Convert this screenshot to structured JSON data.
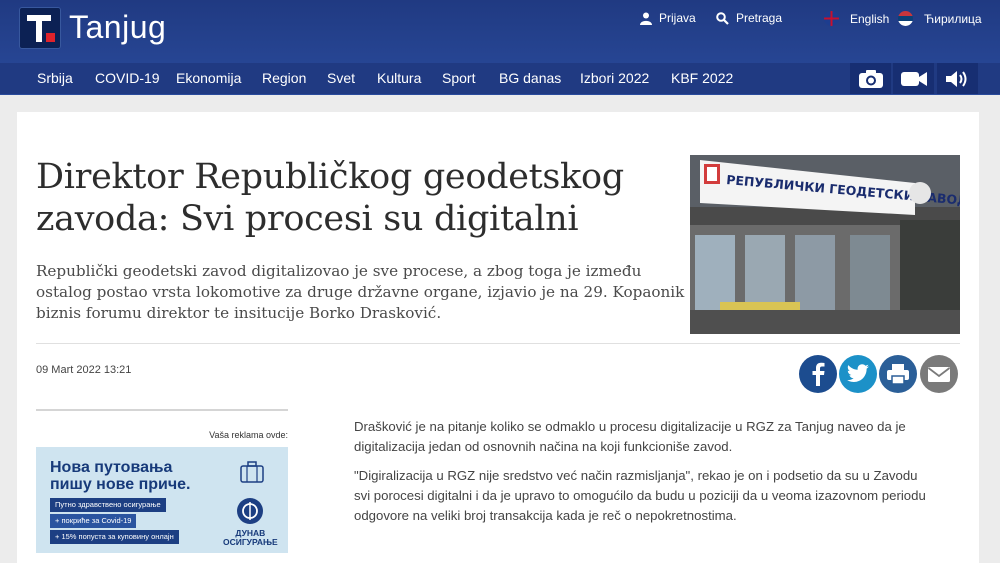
{
  "site": {
    "name": "Tanjug"
  },
  "util": {
    "login": "Prijava",
    "search": "Pretraga",
    "english": "English",
    "cyrillic": "Ћирилица"
  },
  "nav": {
    "items": [
      "Srbija",
      "COVID-19",
      "Ekonomija",
      "Region",
      "Svet",
      "Kultura",
      "Sport",
      "BG danas",
      "Izbori 2022",
      "KBF 2022"
    ]
  },
  "media": {
    "icons": [
      "camera-icon",
      "video-icon",
      "audio-icon"
    ]
  },
  "article": {
    "title": "Direktor Republičkog geodetskog zavoda: Svi procesi su digitalni",
    "lead": "Republički geodetski zavod digitalizovao je sve procese, a zbog toga je između ostalog postao vrsta lokomotive za druge državne organe, izjavio je na 29. Kopaonik biznis forumu direktor te insitucije Borko Drasković.",
    "date": "09 Mart 2022 13:21",
    "paragraphs": [
      "Drašković je na pitanje koliko se odmaklo u procesu digitalizacije u RGZ za Tanjug naveo da je digitalizacija jedan od osnovnih načina na koji funkcioniše zavod.",
      "\"Digiralizacija u RGZ nije sredstvo već način razmisljanja\", rekao je on i podsetio da su u Zavodu svi porocesi digitalni i da je upravo to omogućilo da budu u poziciji da u veoma izazovnom periodu odgovore na veliki broj transakcija kada je reč o nepokretnostima."
    ]
  },
  "photo": {
    "sign": "РЕПУБЛИЧКИ ГЕОДЕТСКИ ЗАВОД"
  },
  "share": {
    "icons": [
      "facebook-icon",
      "twitter-icon",
      "print-icon",
      "email-icon"
    ],
    "colors": [
      "#1c4c8f",
      "#1c91c8",
      "#2b5f98",
      "#7a7a7a"
    ]
  },
  "ad": {
    "label": "Vaša reklama ovde:",
    "headline_1": "Нова путовања",
    "headline_2": "пишу нове приче.",
    "pill_1": "Путно здравствено осигурање",
    "pill_2": "+ покриће за Covid-19",
    "pill_3": "+ 15% попуста за куповину онлајн",
    "brand_1": "ДУНАВ",
    "brand_2": "ОСИГУРАЊЕ"
  },
  "colors": {
    "header": "#203a82",
    "accent_red": "#e0232b"
  }
}
